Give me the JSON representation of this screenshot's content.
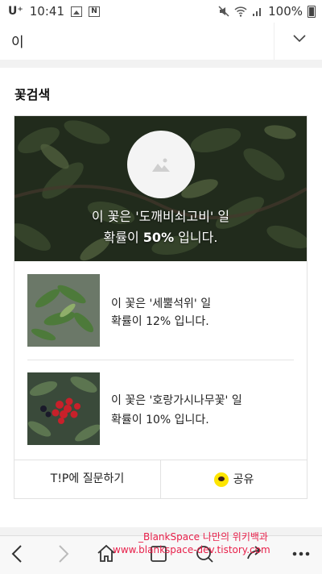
{
  "status_bar": {
    "carrier": "U⁺",
    "time": "10:41",
    "battery": "100%"
  },
  "search": {
    "query": "이"
  },
  "section": {
    "title": "꽃검색"
  },
  "top_result": {
    "line1": "이 꽃은 '도깨비쇠고비' 일",
    "line2_prefix": "확률이 ",
    "percent": "50%",
    "line2_suffix": " 입니다."
  },
  "results": [
    {
      "line1": "이 꽃은 '세뿔석위' 일",
      "line2": "확률이 12% 입니다."
    },
    {
      "line1": "이 꽃은 '호랑가시나무꽃' 일",
      "line2": "확률이 10% 입니다."
    }
  ],
  "actions": {
    "ask": "T!P에 질문하기",
    "share": "공유"
  },
  "watermark": {
    "line1": "_BlankSpace 나만의 위키백과",
    "line2": "www.blankspace-dev.tistory.com"
  },
  "icons": {
    "kakao_color": "#fee500"
  }
}
